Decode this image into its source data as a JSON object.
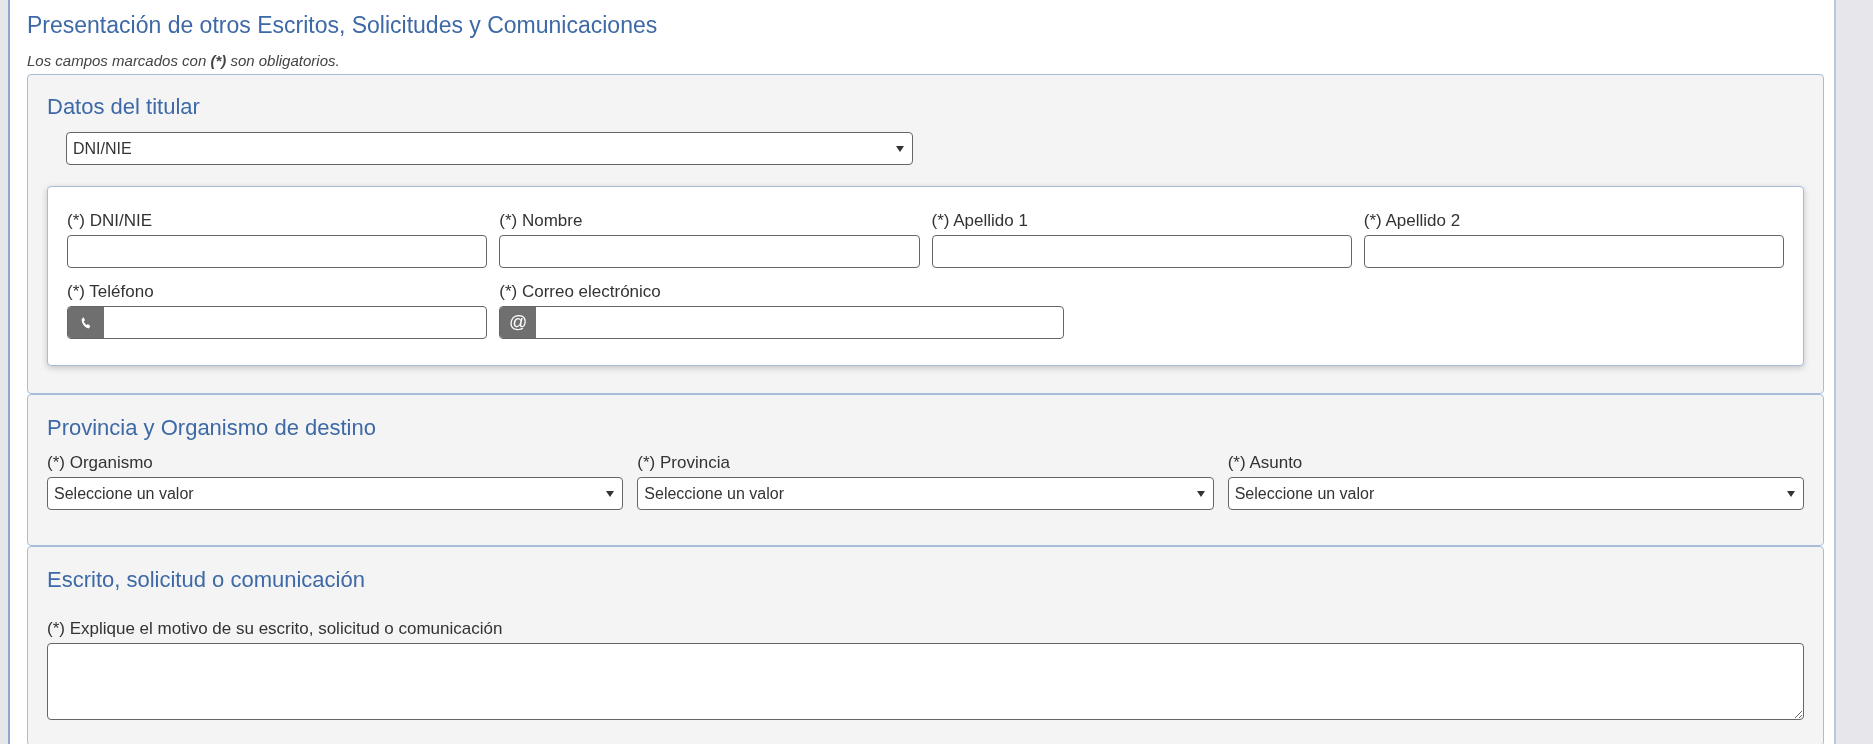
{
  "page_title": "Presentación de otros Escritos, Solicitudes y Comunicaciones",
  "required_note": "Los campos marcados con **(*)** son obligatorios.",
  "titular": {
    "title": "Datos del titular",
    "document_type": {
      "value": "DNI/NIE"
    },
    "fields": [
      {
        "label": "(*) DNI/NIE",
        "kind": "text"
      },
      {
        "label": "(*) Nombre",
        "kind": "text"
      },
      {
        "label": "(*) Apellido 1",
        "kind": "text"
      },
      {
        "label": "(*) Apellido 2",
        "kind": "text"
      },
      {
        "label": "(*) Teléfono",
        "kind": "phone"
      },
      {
        "label": "(*) Correo electrónico",
        "kind": "email",
        "addon": "@"
      }
    ]
  },
  "destino": {
    "title": "Provincia y Organismo de destino",
    "selects": [
      {
        "label": "(*) Organismo",
        "value": "Seleccione un valor"
      },
      {
        "label": "(*) Provincia",
        "value": "Seleccione un valor"
      },
      {
        "label": "(*) Asunto",
        "value": "Seleccione un valor"
      }
    ]
  },
  "escrito": {
    "title": "Escrito, solicitud o comunicación",
    "textarea": {
      "label": "(*) Explique el motivo de su escrito, solicitud o comunicación"
    }
  }
}
